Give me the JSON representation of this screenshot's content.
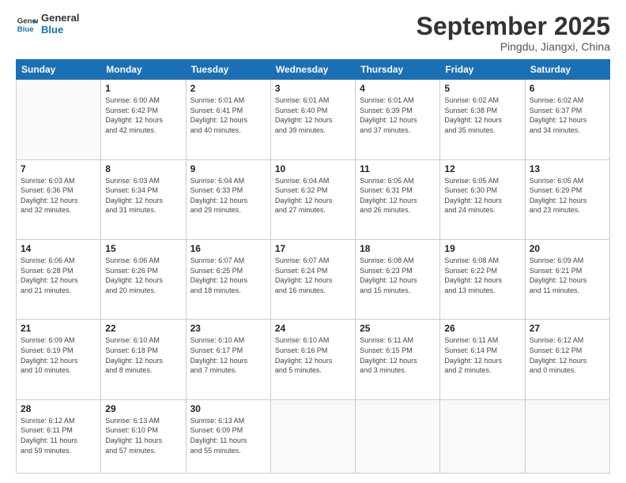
{
  "logo": {
    "line1": "General",
    "line2": "Blue"
  },
  "title": "September 2025",
  "location": "Pingdu, Jiangxi, China",
  "days_header": [
    "Sunday",
    "Monday",
    "Tuesday",
    "Wednesday",
    "Thursday",
    "Friday",
    "Saturday"
  ],
  "weeks": [
    [
      {
        "num": "",
        "info": ""
      },
      {
        "num": "1",
        "info": "Sunrise: 6:00 AM\nSunset: 6:42 PM\nDaylight: 12 hours\nand 42 minutes."
      },
      {
        "num": "2",
        "info": "Sunrise: 6:01 AM\nSunset: 6:41 PM\nDaylight: 12 hours\nand 40 minutes."
      },
      {
        "num": "3",
        "info": "Sunrise: 6:01 AM\nSunset: 6:40 PM\nDaylight: 12 hours\nand 39 minutes."
      },
      {
        "num": "4",
        "info": "Sunrise: 6:01 AM\nSunset: 6:39 PM\nDaylight: 12 hours\nand 37 minutes."
      },
      {
        "num": "5",
        "info": "Sunrise: 6:02 AM\nSunset: 6:38 PM\nDaylight: 12 hours\nand 35 minutes."
      },
      {
        "num": "6",
        "info": "Sunrise: 6:02 AM\nSunset: 6:37 PM\nDaylight: 12 hours\nand 34 minutes."
      }
    ],
    [
      {
        "num": "7",
        "info": "Sunrise: 6:03 AM\nSunset: 6:36 PM\nDaylight: 12 hours\nand 32 minutes."
      },
      {
        "num": "8",
        "info": "Sunrise: 6:03 AM\nSunset: 6:34 PM\nDaylight: 12 hours\nand 31 minutes."
      },
      {
        "num": "9",
        "info": "Sunrise: 6:04 AM\nSunset: 6:33 PM\nDaylight: 12 hours\nand 29 minutes."
      },
      {
        "num": "10",
        "info": "Sunrise: 6:04 AM\nSunset: 6:32 PM\nDaylight: 12 hours\nand 27 minutes."
      },
      {
        "num": "11",
        "info": "Sunrise: 6:05 AM\nSunset: 6:31 PM\nDaylight: 12 hours\nand 26 minutes."
      },
      {
        "num": "12",
        "info": "Sunrise: 6:05 AM\nSunset: 6:30 PM\nDaylight: 12 hours\nand 24 minutes."
      },
      {
        "num": "13",
        "info": "Sunrise: 6:05 AM\nSunset: 6:29 PM\nDaylight: 12 hours\nand 23 minutes."
      }
    ],
    [
      {
        "num": "14",
        "info": "Sunrise: 6:06 AM\nSunset: 6:28 PM\nDaylight: 12 hours\nand 21 minutes."
      },
      {
        "num": "15",
        "info": "Sunrise: 6:06 AM\nSunset: 6:26 PM\nDaylight: 12 hours\nand 20 minutes."
      },
      {
        "num": "16",
        "info": "Sunrise: 6:07 AM\nSunset: 6:25 PM\nDaylight: 12 hours\nand 18 minutes."
      },
      {
        "num": "17",
        "info": "Sunrise: 6:07 AM\nSunset: 6:24 PM\nDaylight: 12 hours\nand 16 minutes."
      },
      {
        "num": "18",
        "info": "Sunrise: 6:08 AM\nSunset: 6:23 PM\nDaylight: 12 hours\nand 15 minutes."
      },
      {
        "num": "19",
        "info": "Sunrise: 6:08 AM\nSunset: 6:22 PM\nDaylight: 12 hours\nand 13 minutes."
      },
      {
        "num": "20",
        "info": "Sunrise: 6:09 AM\nSunset: 6:21 PM\nDaylight: 12 hours\nand 11 minutes."
      }
    ],
    [
      {
        "num": "21",
        "info": "Sunrise: 6:09 AM\nSunset: 6:19 PM\nDaylight: 12 hours\nand 10 minutes."
      },
      {
        "num": "22",
        "info": "Sunrise: 6:10 AM\nSunset: 6:18 PM\nDaylight: 12 hours\nand 8 minutes."
      },
      {
        "num": "23",
        "info": "Sunrise: 6:10 AM\nSunset: 6:17 PM\nDaylight: 12 hours\nand 7 minutes."
      },
      {
        "num": "24",
        "info": "Sunrise: 6:10 AM\nSunset: 6:16 PM\nDaylight: 12 hours\nand 5 minutes."
      },
      {
        "num": "25",
        "info": "Sunrise: 6:11 AM\nSunset: 6:15 PM\nDaylight: 12 hours\nand 3 minutes."
      },
      {
        "num": "26",
        "info": "Sunrise: 6:11 AM\nSunset: 6:14 PM\nDaylight: 12 hours\nand 2 minutes."
      },
      {
        "num": "27",
        "info": "Sunrise: 6:12 AM\nSunset: 6:12 PM\nDaylight: 12 hours\nand 0 minutes."
      }
    ],
    [
      {
        "num": "28",
        "info": "Sunrise: 6:12 AM\nSunset: 6:11 PM\nDaylight: 11 hours\nand 59 minutes."
      },
      {
        "num": "29",
        "info": "Sunrise: 6:13 AM\nSunset: 6:10 PM\nDaylight: 11 hours\nand 57 minutes."
      },
      {
        "num": "30",
        "info": "Sunrise: 6:13 AM\nSunset: 6:09 PM\nDaylight: 11 hours\nand 55 minutes."
      },
      {
        "num": "",
        "info": ""
      },
      {
        "num": "",
        "info": ""
      },
      {
        "num": "",
        "info": ""
      },
      {
        "num": "",
        "info": ""
      }
    ]
  ]
}
